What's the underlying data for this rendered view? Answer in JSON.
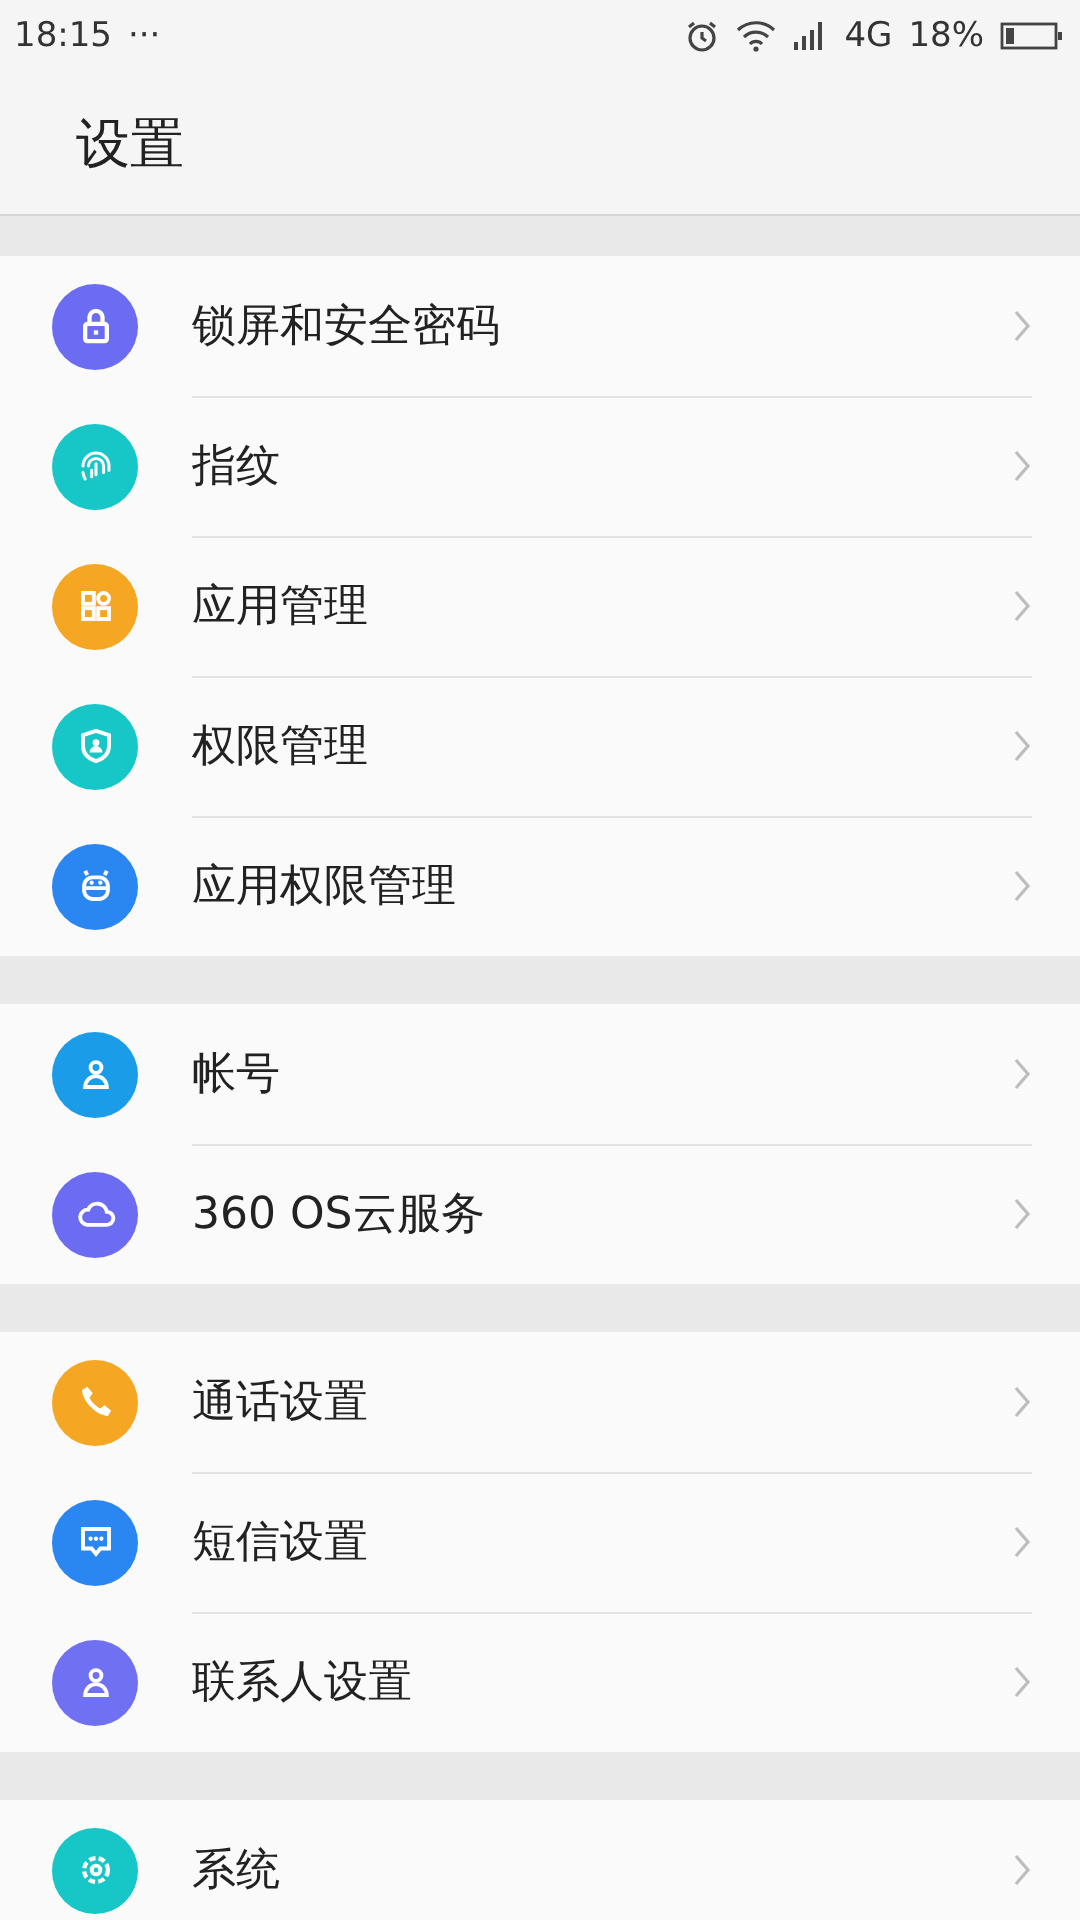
{
  "status_bar": {
    "time": "18:15",
    "more": "···",
    "network": "4G",
    "battery": "18%"
  },
  "header": {
    "title": "设置"
  },
  "groups": [
    {
      "items": [
        {
          "label": "锁屏和安全密码",
          "color": "#6c6cf2"
        },
        {
          "label": "指纹",
          "color": "#17c6c6"
        },
        {
          "label": "应用管理",
          "color": "#f5a623"
        },
        {
          "label": "权限管理",
          "color": "#17c6c6"
        },
        {
          "label": "应用权限管理",
          "color": "#2a86f0"
        }
      ]
    },
    {
      "items": [
        {
          "label": "帐号",
          "color": "#1b9ce8"
        },
        {
          "label": "360 OS云服务",
          "color": "#6c6cf2"
        }
      ]
    },
    {
      "items": [
        {
          "label": "通话设置",
          "color": "#f5a623"
        },
        {
          "label": "短信设置",
          "color": "#2a86f0"
        },
        {
          "label": "联系人设置",
          "color": "#7070f2"
        }
      ]
    },
    {
      "items": [
        {
          "label": "系统",
          "color": "#17c6c6"
        }
      ]
    }
  ]
}
